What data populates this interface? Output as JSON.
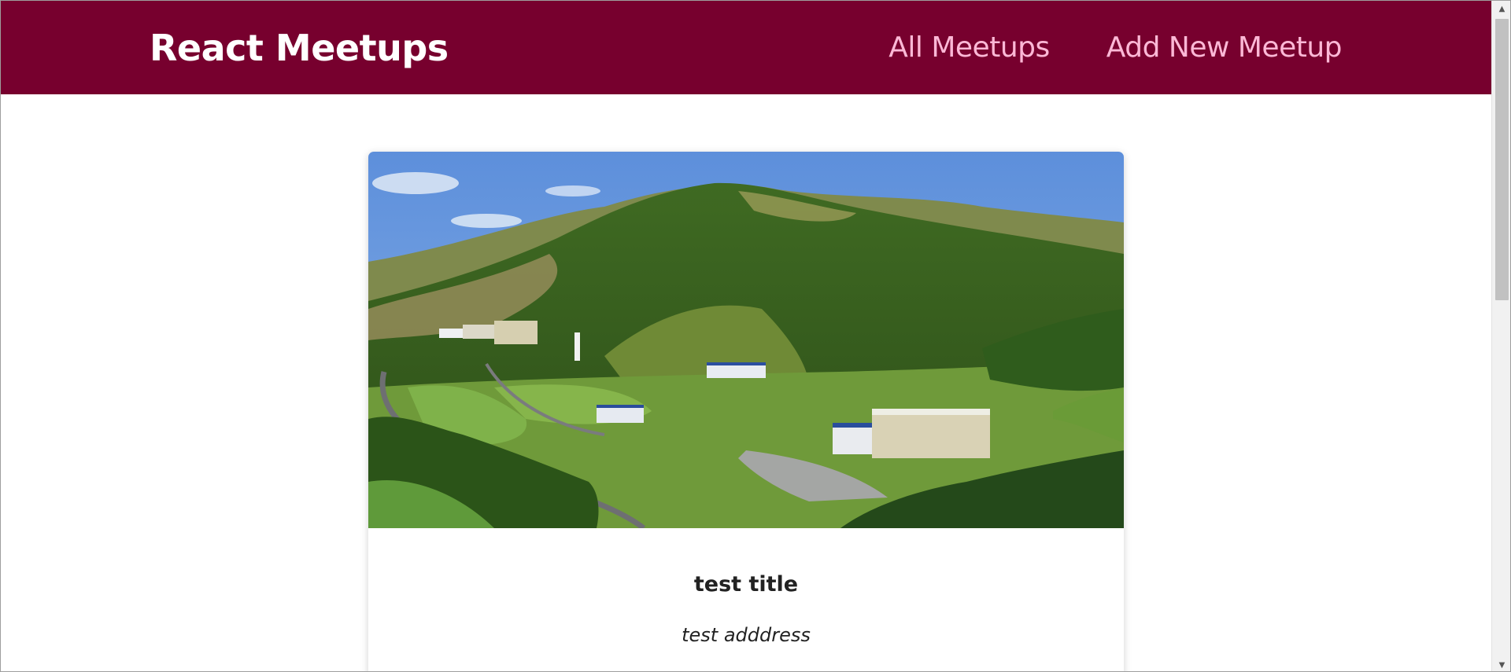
{
  "header": {
    "logo": "React Meetups",
    "nav": [
      {
        "label": "All Meetups"
      },
      {
        "label": "Add New Meetup"
      }
    ]
  },
  "meetup": {
    "title": "test title",
    "address": "test adddress",
    "image_alt": "Aerial view of an industrial campus in a green hilly valley"
  },
  "colors": {
    "header_bg": "#77002e",
    "nav_link": "#fcb8d6",
    "logo": "#ffffff"
  },
  "scrollbar": {
    "up_icon": "arrow-up-icon",
    "down_icon": "arrow-down-icon"
  }
}
